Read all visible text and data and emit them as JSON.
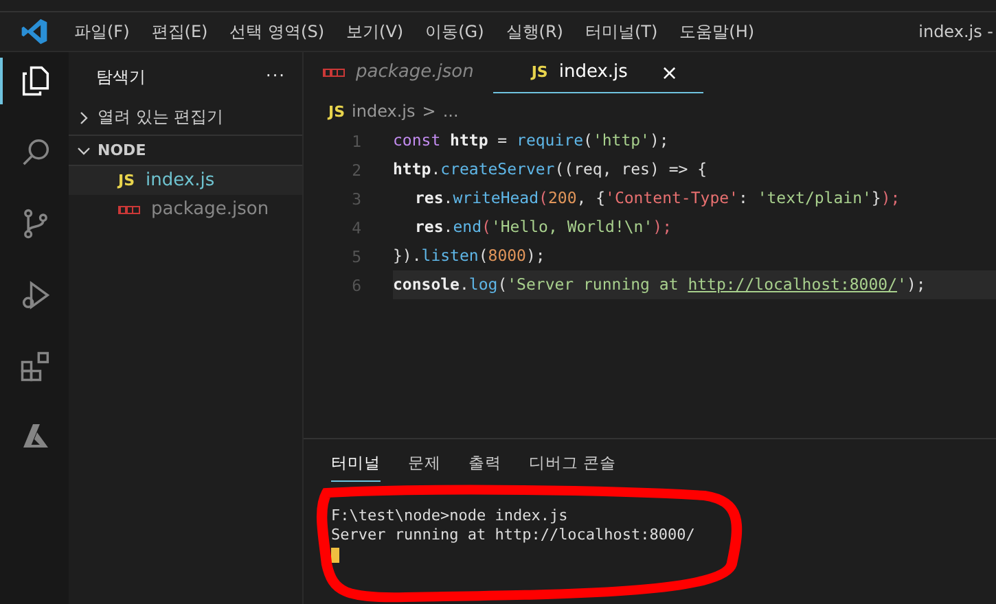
{
  "menu_bar": {
    "items": [
      "파일(F)",
      "편집(E)",
      "선택 영역(S)",
      "보기(V)",
      "이동(G)",
      "실행(R)",
      "터미널(T)",
      "도움말(H)"
    ],
    "title": "index.js -"
  },
  "activity_bar": [
    {
      "kind": "files",
      "selected": true
    },
    {
      "kind": "search",
      "selected": false
    },
    {
      "kind": "source-control",
      "selected": false
    },
    {
      "kind": "debug",
      "selected": false
    },
    {
      "kind": "extensions",
      "selected": false
    },
    {
      "kind": "azure",
      "selected": false
    }
  ],
  "sidebar": {
    "title": "탐색기",
    "more": "···",
    "sections": [
      {
        "label": "열려 있는 편집기",
        "expanded": false,
        "bold": false
      },
      {
        "label": "NODE",
        "expanded": true,
        "bold": true,
        "children": [
          {
            "label": "index.js",
            "kind": "js",
            "badge": "JS",
            "selected": true
          },
          {
            "label": "package.json",
            "kind": "npm",
            "selected": false
          }
        ]
      }
    ]
  },
  "editor_tabs": [
    {
      "label": "package.json",
      "kind": "npm",
      "selected": false,
      "preview": true
    },
    {
      "label": "index.js",
      "kind": "js",
      "badge": "JS",
      "selected": true,
      "preview": false,
      "close": "×"
    }
  ],
  "breadcrumb": {
    "badge": "JS",
    "file": "index.js",
    "separator": ">",
    "rest": "..."
  },
  "code_lines": [
    {
      "number": "1",
      "highlighted": false,
      "tokens": [
        {
          "text": "const ",
          "kind": "keyword"
        },
        {
          "text": "http",
          "kind": "variable"
        },
        {
          "text": " = ",
          "kind": "plain"
        },
        {
          "text": "require",
          "kind": "function"
        },
        {
          "text": "(",
          "kind": "plain"
        },
        {
          "text": "'http'",
          "kind": "string"
        },
        {
          "text": ");",
          "kind": "plain"
        }
      ]
    },
    {
      "number": "2",
      "highlighted": false,
      "tokens": [
        {
          "text": "http",
          "kind": "variable"
        },
        {
          "text": ".",
          "kind": "plain"
        },
        {
          "text": "createServer",
          "kind": "function"
        },
        {
          "text": "((req, res) => {",
          "kind": "plain"
        }
      ],
      "children": [
        {
          "number": "3",
          "highlighted": false,
          "tokens": [
            {
              "text": "res",
              "kind": "variable"
            },
            {
              "text": ".",
              "kind": "plain"
            },
            {
              "text": "writeHead",
              "kind": "function"
            },
            {
              "text": "(",
              "kind": "paren"
            },
            {
              "text": "200",
              "kind": "number"
            },
            {
              "text": ", {",
              "kind": "plain"
            },
            {
              "text": "'Content-Type'",
              "kind": "key"
            },
            {
              "text": ": ",
              "kind": "plain"
            },
            {
              "text": "'text/plain'",
              "kind": "string"
            },
            {
              "text": "}",
              "kind": "plain"
            },
            {
              "text": ");",
              "kind": "paren"
            }
          ]
        },
        {
          "number": "4",
          "highlighted": false,
          "tokens": [
            {
              "text": "res",
              "kind": "variable"
            },
            {
              "text": ".",
              "kind": "plain"
            },
            {
              "text": "end",
              "kind": "function"
            },
            {
              "text": "(",
              "kind": "paren"
            },
            {
              "text": "'Hello, World!\\n'",
              "kind": "string"
            },
            {
              "text": ");",
              "kind": "paren"
            }
          ]
        }
      ]
    },
    {
      "number": "5",
      "highlighted": false,
      "tokens": [
        {
          "text": "}).",
          "kind": "plain"
        },
        {
          "text": "listen",
          "kind": "function"
        },
        {
          "text": "(",
          "kind": "plain"
        },
        {
          "text": "8000",
          "kind": "number"
        },
        {
          "text": ");",
          "kind": "plain"
        }
      ]
    },
    {
      "number": "6",
      "highlighted": true,
      "tokens": [
        {
          "text": "console",
          "kind": "variable"
        },
        {
          "text": ".",
          "kind": "plain"
        },
        {
          "text": "log",
          "kind": "function"
        },
        {
          "text": "(",
          "kind": "plain"
        },
        {
          "text": "'Server running at ",
          "kind": "string"
        },
        {
          "text": "http://localhost:8000/",
          "kind": "link"
        },
        {
          "text": "'",
          "kind": "string"
        },
        {
          "text": ");",
          "kind": "plain"
        }
      ]
    }
  ],
  "panel": {
    "tabs": [
      {
        "label": "터미널",
        "selected": true
      },
      {
        "label": "문제",
        "selected": false
      },
      {
        "label": "출력",
        "selected": false
      },
      {
        "label": "디버그 콘솔",
        "selected": false
      }
    ],
    "terminal_lines": [
      "F:\\test\\node>node index.js",
      "Server running at http://localhost:8000/"
    ]
  }
}
